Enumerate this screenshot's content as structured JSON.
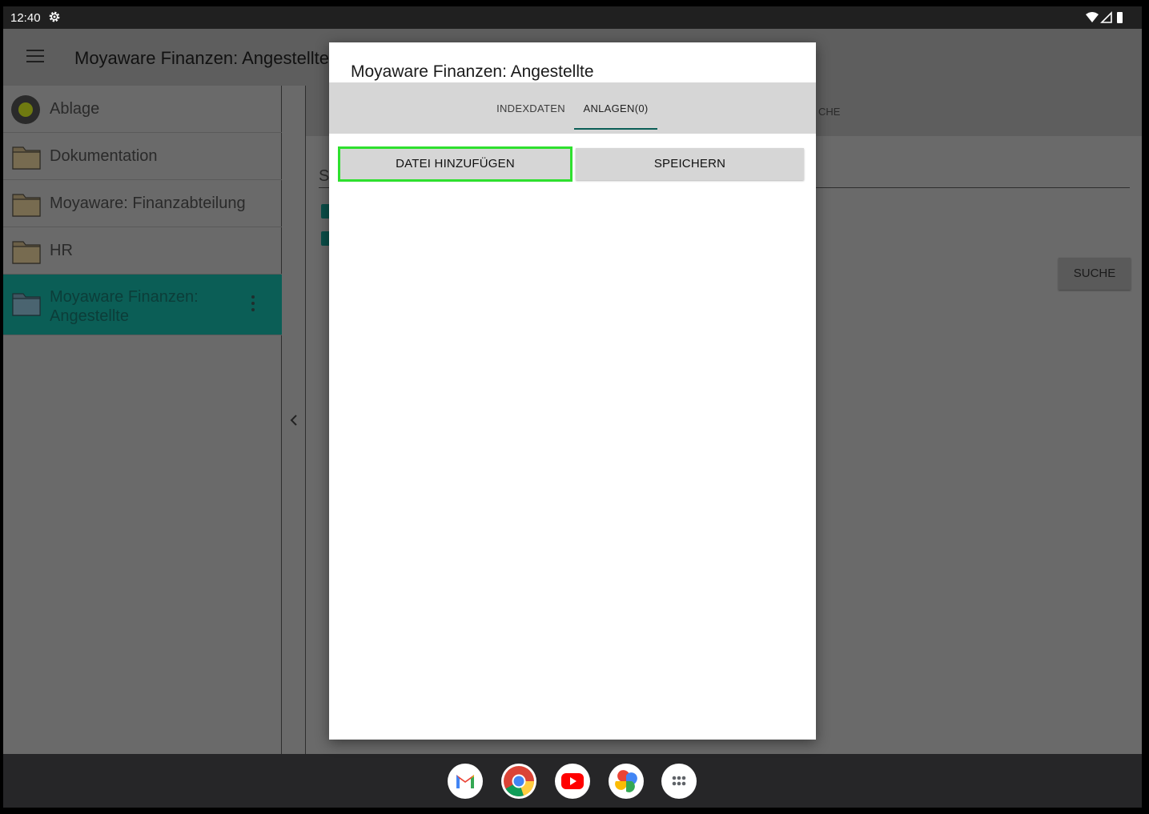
{
  "status_bar": {
    "time": "12:40"
  },
  "app_bar": {
    "title": "Moyaware Finanzen: Angestellte"
  },
  "sidebar": {
    "items": [
      {
        "label": "Ablage"
      },
      {
        "label": "Dokumentation"
      },
      {
        "label": "Moyaware: Finanzabteilung"
      },
      {
        "label": "HR"
      },
      {
        "label": "Moyaware Finanzen: Angestellte"
      }
    ]
  },
  "background": {
    "tab_fragment": "CHE",
    "field_fragment": "S",
    "search_button": "SUCHE"
  },
  "dialog": {
    "title": "Moyaware Finanzen: Angestellte",
    "tabs": [
      {
        "label": "INDEXDATEN"
      },
      {
        "label": "ANLAGEN(0)"
      }
    ],
    "add_file_button": "DATEI HINZUFÜGEN",
    "save_button": "SPEICHERN"
  },
  "dock": {
    "apps": [
      "gmail-icon",
      "chrome-icon",
      "youtube-icon",
      "photos-icon",
      "app-drawer-icon"
    ]
  },
  "colors": {
    "accent": "#0b5e56",
    "highlight": "#2ee02e"
  }
}
